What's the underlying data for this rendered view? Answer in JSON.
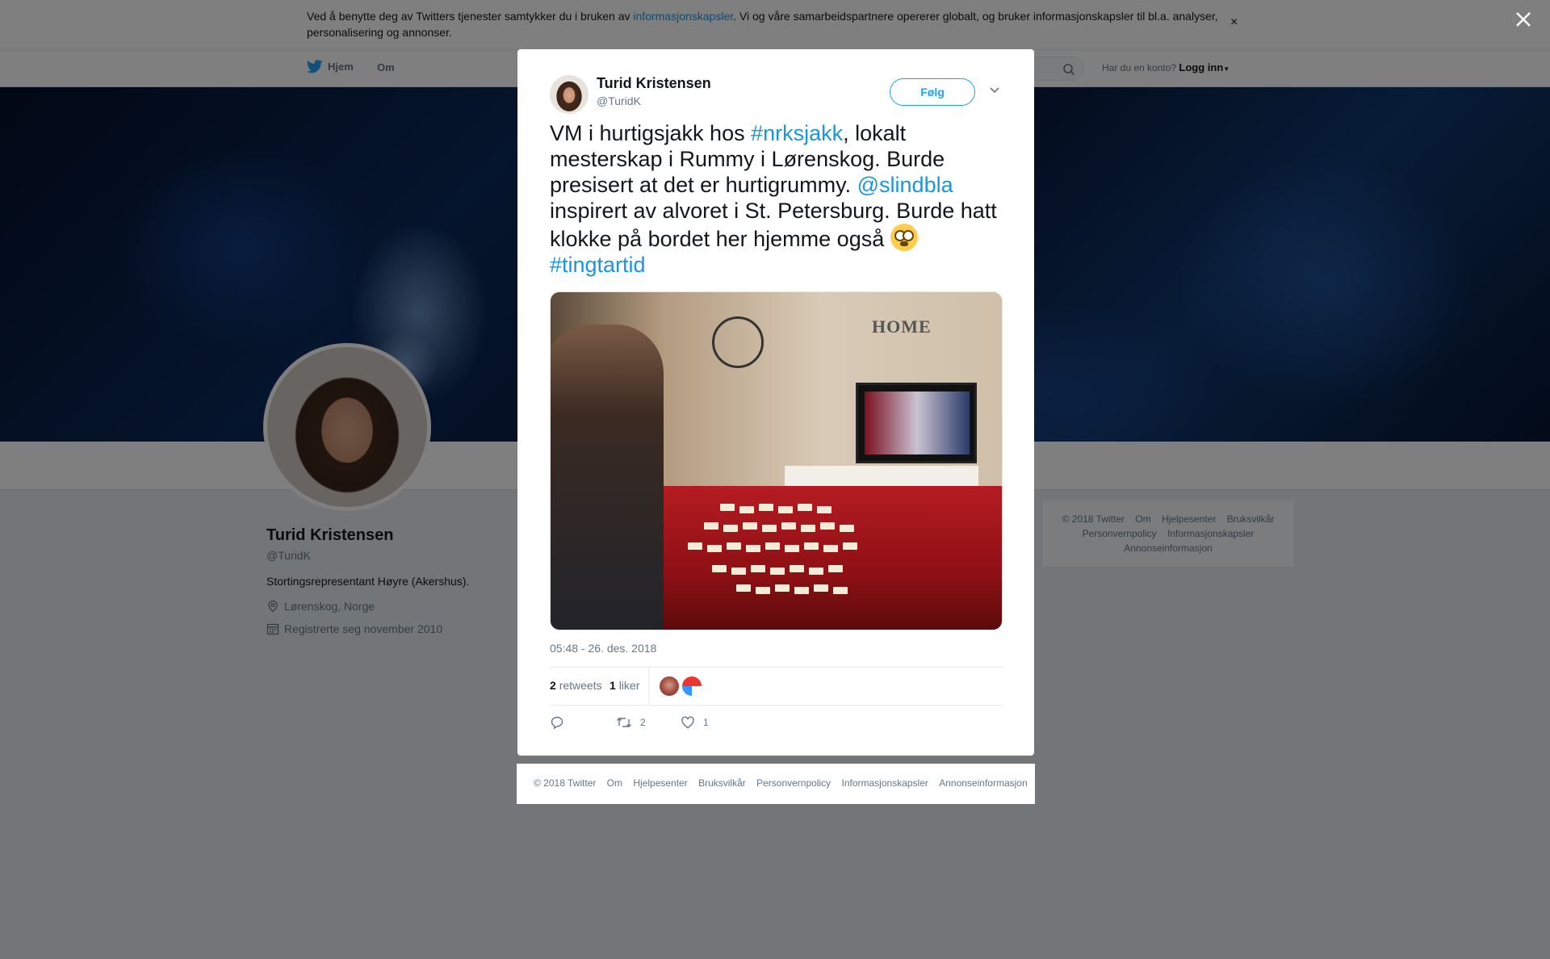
{
  "cookie": {
    "text_before": "Ved å benytte deg av Twitters tjenester samtykker du i bruken av ",
    "link": "informasjonskapsler",
    "text_after": ". Vi og våre samarbeidspartnere opererer globalt, og bruker informasjonskapsler til bl.a. analyser, personalisering og annonser.",
    "close": "×"
  },
  "nav": {
    "home": "Hjem",
    "about": "Om",
    "account_prompt": "Har du en konto?",
    "login": "Logg inn"
  },
  "profile": {
    "name": "Turid Kristensen",
    "handle": "@TuridK",
    "bio": "Stortingsrepresentant Høyre (Akershus).",
    "location": "Lørenskog, Norge",
    "joined": "Registrerte seg november 2010"
  },
  "side_footer": [
    "© 2018 Twitter",
    "Om",
    "Hjelpesenter",
    "Bruksvilkår",
    "Personvernpolicy",
    "Informasjonskapsler",
    "Annonseinformasjon"
  ],
  "tweet": {
    "name": "Turid Kristensen",
    "handle": "@TuridK",
    "follow_label": "Følg",
    "text_1": "VM i hurtigsjakk hos ",
    "hashtag_1": "#nrksjakk",
    "text_2": ", lokalt mesterskap i Rummy i Lørenskog. Burde presisert at det er hurtigrummy. ",
    "mention": "@slindbla",
    "text_3": " inspirert av alvoret i St. Petersburg. Burde hatt klokke på bordet her hjemme også ",
    "hashtag_2": "#tingtartid",
    "photo_sign": "HOME",
    "timestamp": "05:48 - 26. des. 2018",
    "retweets_count": "2",
    "retweets_label": "retweets",
    "likes_count": "1",
    "likes_label": "liker",
    "action_retweet_count": "2",
    "action_like_count": "1"
  },
  "modal_footer": [
    "© 2018 Twitter",
    "Om",
    "Hjelpesenter",
    "Bruksvilkår",
    "Personvernpolicy",
    "Informasjonskapsler",
    "Annonseinformasjon"
  ],
  "colors": {
    "link": "#1b95e0",
    "twitter_blue": "#1da1f2",
    "muted": "#657786"
  }
}
